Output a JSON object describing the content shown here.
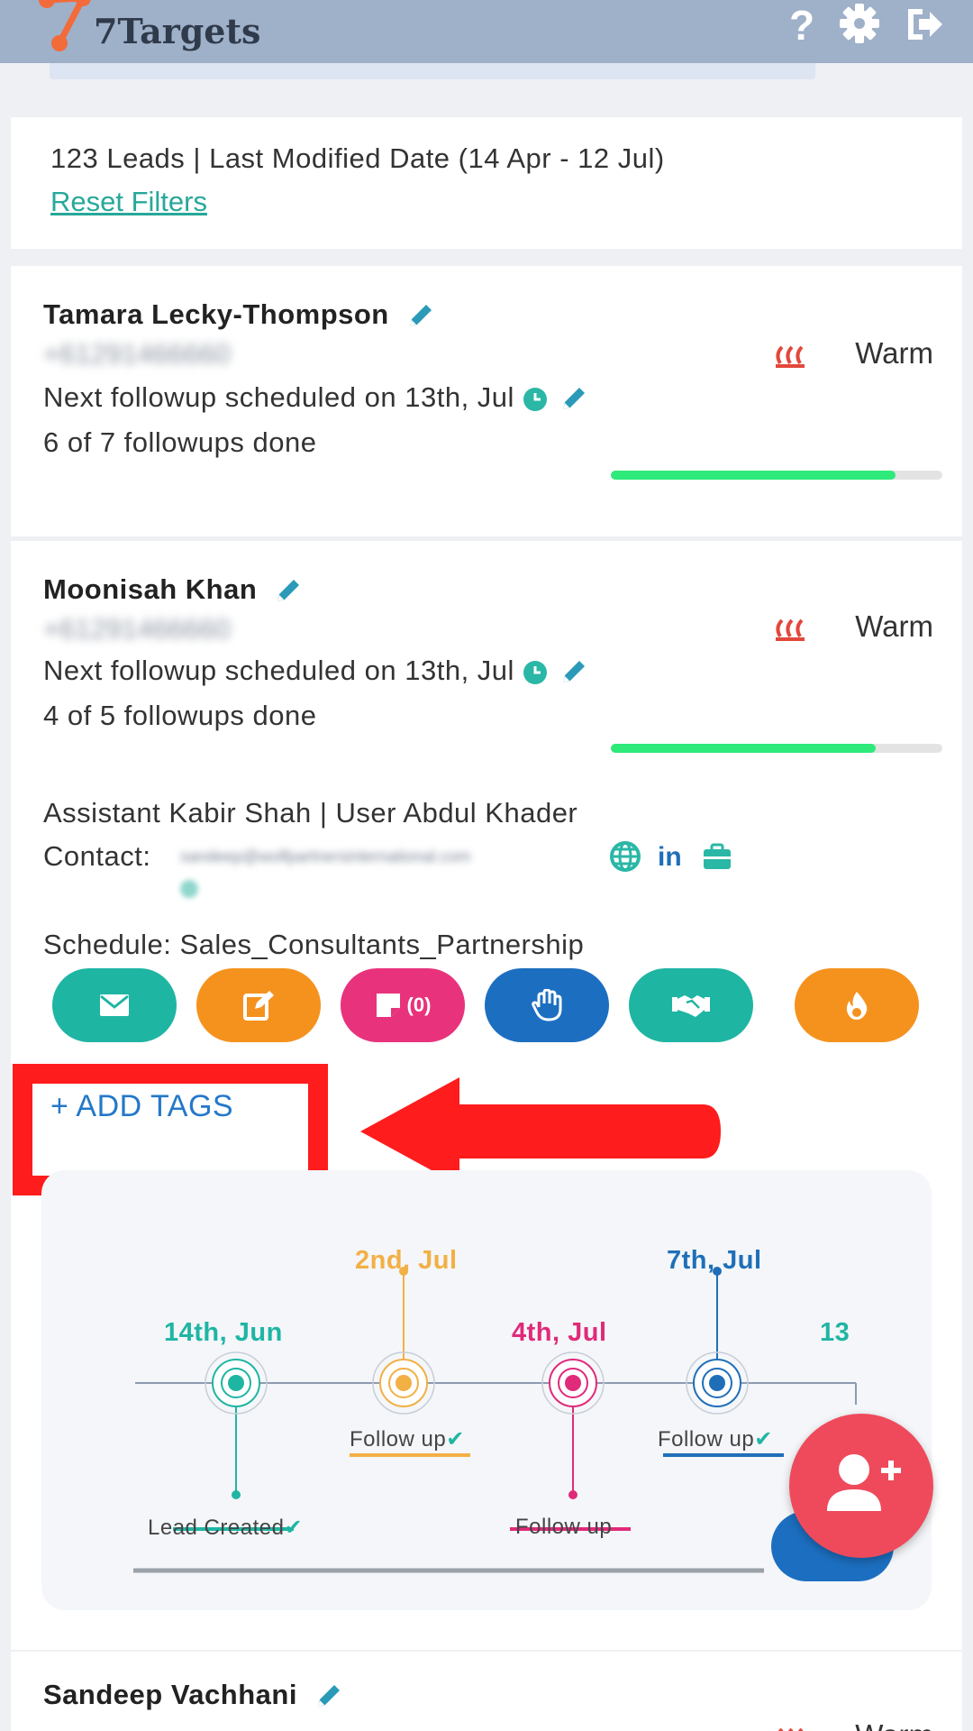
{
  "header": {
    "brand": "7Targets",
    "icons": [
      "help-icon",
      "settings-icon",
      "logout-icon"
    ]
  },
  "summary": {
    "text": "123 Leads | Last Modified Date (14 Apr - 12 Jul)",
    "reset": "Reset Filters"
  },
  "leads": [
    {
      "name": "Tamara Lecky-Thompson",
      "phone": "+61291466660",
      "status": "Warm",
      "next_followup": "Next followup scheduled on 13th, Jul",
      "done": "6 of 7 followups done",
      "progress": 0.86
    },
    {
      "name": "Moonisah Khan",
      "phone": "+61291466660",
      "status": "Warm",
      "next_followup": "Next followup scheduled on 13th, Jul",
      "done": "4 of 5 followups done",
      "progress": 0.8,
      "assistant": "Assistant Kabir Shah | User Abdul Khader",
      "contact_label": "Contact:",
      "contact_email": "sandeep@wolfpartnersinternational.com",
      "schedule": "Schedule:  Sales_Consultants_Partnership",
      "notes_count": "(0)",
      "add_tags": "+ ADD TAGS",
      "timeline": {
        "events": [
          {
            "date": "14th, Jun",
            "label": "Lead Created",
            "done": true,
            "color": "#1fb5a3"
          },
          {
            "date": "2nd, Jul",
            "label": "Follow up",
            "done": true,
            "color": "#f2b045"
          },
          {
            "date": "4th, Jul",
            "label": "Follow up",
            "done": false,
            "color": "#e02a7a"
          },
          {
            "date": "7th, Jul",
            "label": "Follow up",
            "done": true,
            "color": "#1f6fb8"
          },
          {
            "date": "13",
            "label": "",
            "done": false,
            "color": "#1fb5a3"
          }
        ]
      }
    },
    {
      "name": "Sandeep Vachhani",
      "status": "Warm"
    }
  ],
  "colors": {
    "teal": "#1fb5a3",
    "orange": "#f5921e",
    "pink": "#e8337c",
    "blue": "#1c6fc0",
    "red_fab": "#ef4a5c",
    "annotation": "#ff1c1c"
  }
}
